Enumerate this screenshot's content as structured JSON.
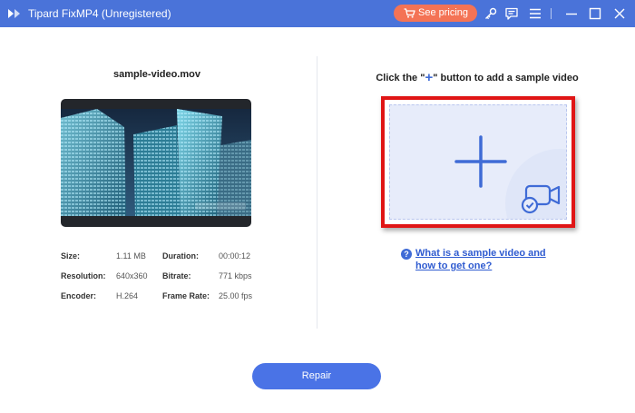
{
  "window": {
    "title": "Tipard FixMP4 (Unregistered)",
    "pricing_label": "See pricing",
    "icons": [
      "key-icon",
      "feedback-icon",
      "menu-icon",
      "minimize-icon",
      "maximize-icon",
      "close-icon"
    ]
  },
  "sample_panel": {
    "filename": "sample-video.mov",
    "info": {
      "size_label": "Size:",
      "size_value": "1.11 MB",
      "duration_label": "Duration:",
      "duration_value": "00:00:12",
      "resolution_label": "Resolution:",
      "resolution_value": "640x360",
      "bitrate_label": "Bitrate:",
      "bitrate_value": "771 kbps",
      "encoder_label": "Encoder:",
      "encoder_value": "H.264",
      "framerate_label": "Frame Rate:",
      "framerate_value": "25.00 fps"
    }
  },
  "add_panel": {
    "hint_before": "Click the \"",
    "hint_plus": "+",
    "hint_after": "\" button to add a sample video",
    "help_link": "What is a sample video and how to get one?",
    "help_icon": "?"
  },
  "footer": {
    "repair_label": "Repair"
  },
  "colors": {
    "titlebar": "#4a73d9",
    "pricing": "#f47355",
    "accent": "#3f6bd6",
    "highlight_frame": "#e01515",
    "repair": "#4a73e6"
  }
}
